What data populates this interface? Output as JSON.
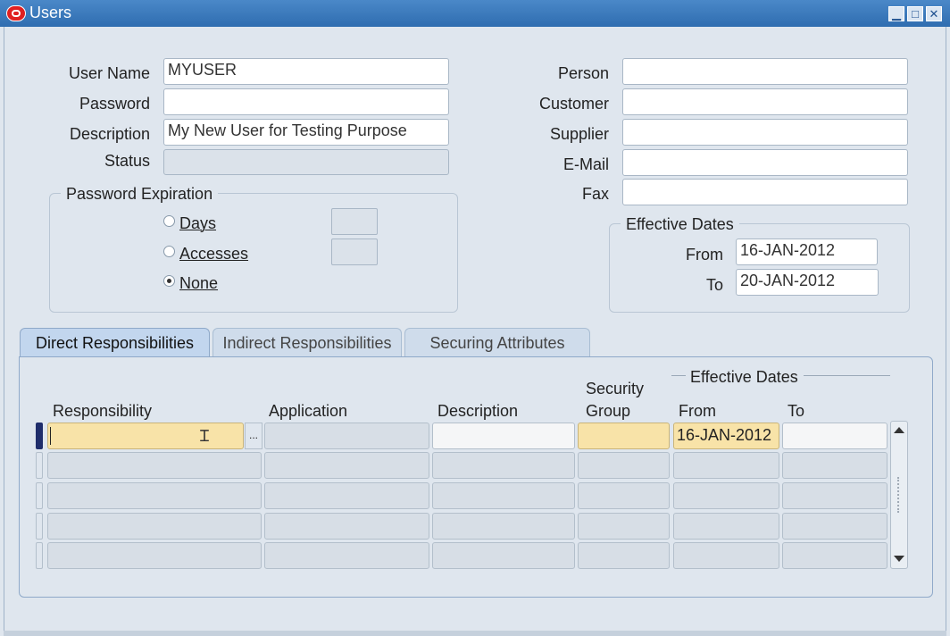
{
  "window": {
    "title": "Users",
    "controls": [
      "minimize-icon",
      "maximize-icon",
      "close-icon"
    ]
  },
  "user_info": {
    "user_name_label": "User Name",
    "user_name_value": "MYUSER",
    "password_label": "Password",
    "password_value": "",
    "description_label": "Description",
    "description_value": "My New User for Testing Purpose",
    "status_label": "Status",
    "status_value": ""
  },
  "links": {
    "person_label": "Person",
    "customer_label": "Customer",
    "supplier_label": "Supplier",
    "email_label": "E-Mail",
    "fax_label": "Fax"
  },
  "password_expiration": {
    "title": "Password Expiration",
    "days_label": "Days",
    "accesses_label": "Accesses",
    "none_label": "None",
    "selected": "None"
  },
  "effective_dates": {
    "title": "Effective Dates",
    "from_label": "From",
    "from_value": "16-JAN-2012",
    "to_label": "To",
    "to_value": "20-JAN-2012"
  },
  "tabs": [
    {
      "label": "Direct Responsibilities",
      "active": true
    },
    {
      "label": "Indirect Responsibilities",
      "active": false
    },
    {
      "label": "Securing Attributes",
      "active": false
    }
  ],
  "grid": {
    "effective_dates_title": "Effective Dates",
    "columns": {
      "responsibility": "Responsibility",
      "application": "Application",
      "description": "Description",
      "security_group_line1": "Security",
      "security_group_line2": "Group",
      "from": "From",
      "to": "To"
    },
    "lov_button": "...",
    "rows": [
      {
        "responsibility": "",
        "application": "",
        "description": "",
        "security_group": "",
        "from": "16-JAN-2012",
        "to": ""
      },
      {
        "responsibility": "",
        "application": "",
        "description": "",
        "security_group": "",
        "from": "",
        "to": ""
      },
      {
        "responsibility": "",
        "application": "",
        "description": "",
        "security_group": "",
        "from": "",
        "to": ""
      },
      {
        "responsibility": "",
        "application": "",
        "description": "",
        "security_group": "",
        "from": "",
        "to": ""
      },
      {
        "responsibility": "",
        "application": "",
        "description": "",
        "security_group": "",
        "from": "",
        "to": ""
      }
    ]
  },
  "colors": {
    "titlebar": "#2f6db0",
    "required_field": "#f8e3a8",
    "background": "#dfe6ee",
    "current_record": "#1f2d6b"
  }
}
